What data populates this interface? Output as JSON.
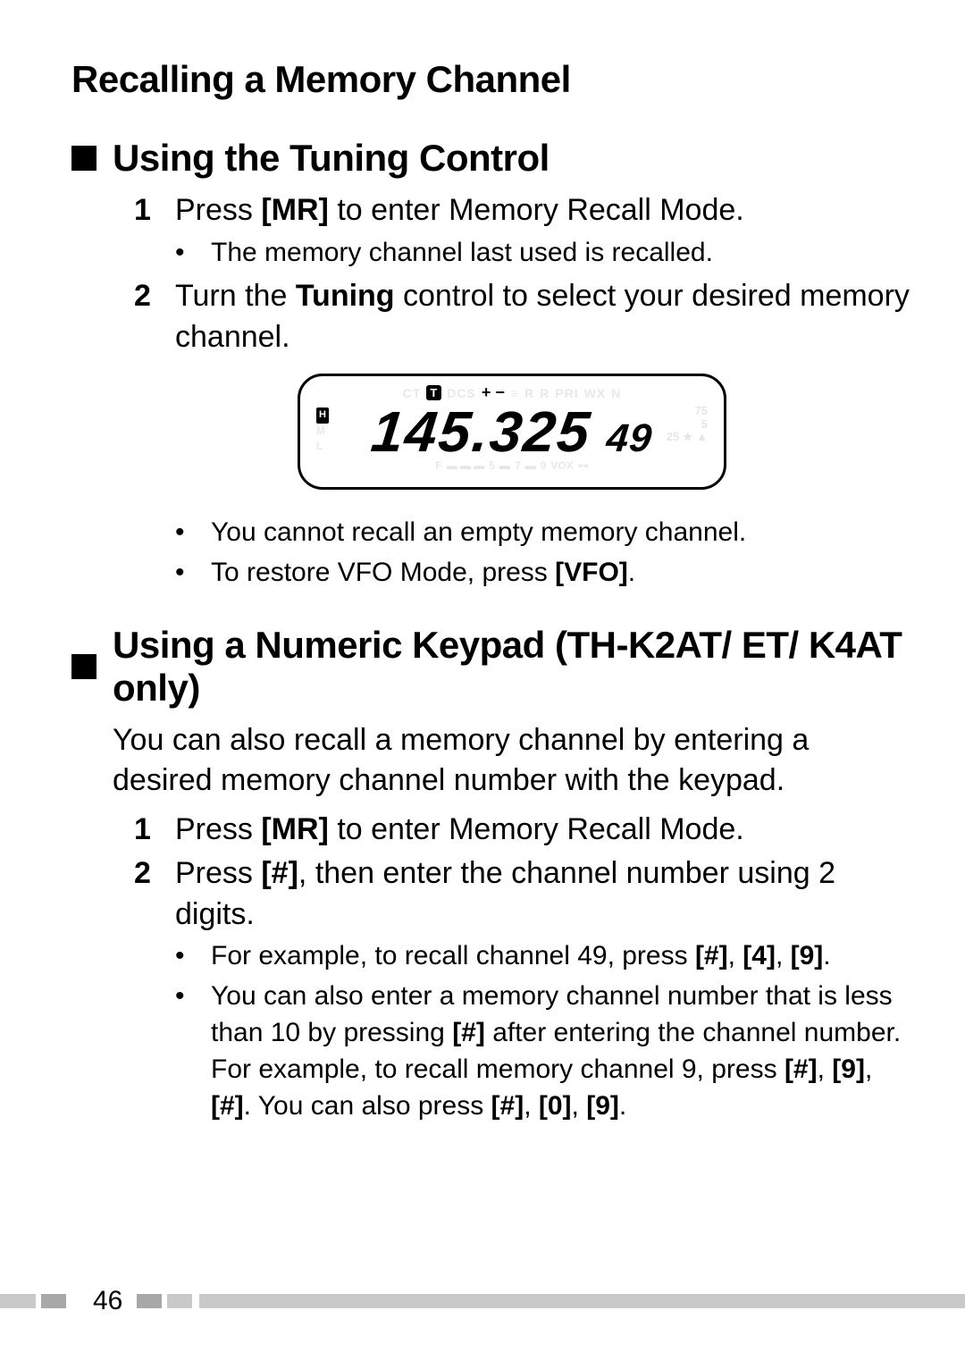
{
  "title": "Recalling a Memory Channel",
  "section1": {
    "heading": "Using the Tuning Control",
    "steps": {
      "s1": {
        "n": "1",
        "pre": "Press ",
        "key": "[MR]",
        "post": " to enter Memory Recall Mode."
      },
      "s1_bul1": "The memory channel last used is recalled.",
      "s2": {
        "n": "2",
        "pre": "Turn the ",
        "key": "Tuning",
        "post": " control to select your desired memory channel."
      },
      "s2_bul1": "You cannot recall an empty memory channel.",
      "s2_bul2_pre": "To restore VFO Mode, press ",
      "s2_bul2_key": "[VFO]",
      "s2_bul2_post": "."
    }
  },
  "lcd": {
    "topline": {
      "ct": "CT",
      "t": "T",
      "dcs": "DCS",
      "r": "R",
      "r2": "R",
      "pri": "PRI",
      "wx": "WX",
      "n": "N"
    },
    "left": {
      "h": "H",
      "m": "M",
      "l": "L"
    },
    "right": {
      "a": "75",
      "b": "5",
      "c": "25",
      "star": "★",
      "tri": "▲"
    },
    "freq": "145.325",
    "chan": "49",
    "bottom": {
      "f": "F",
      "segA": "5",
      "segB": "7",
      "segC": "9",
      "vox": "VOX",
      "key": "⊶"
    }
  },
  "section2": {
    "heading": "Using a Numeric Keypad (TH-K2AT/ ET/ K4AT only)",
    "intro": "You can also recall a memory channel by entering a desired memory channel number with the keypad.",
    "steps": {
      "s1": {
        "n": "1",
        "pre": "Press ",
        "key": "[MR]",
        "post": " to enter Memory Recall Mode."
      },
      "s2": {
        "n": "2",
        "pre": "Press ",
        "key": "[#]",
        "post": ", then enter the channel number using 2 digits."
      },
      "s2_bul1_pre": "For example, to recall channel 49, press ",
      "s2_bul1_k1": "[#]",
      "s2_bul1_c1": ", ",
      "s2_bul1_k2": "[4]",
      "s2_bul1_c2": ", ",
      "s2_bul1_k3": "[9]",
      "s2_bul1_post": ".",
      "s2_bul2_a": "You can also enter a memory channel number that is less than 10 by pressing ",
      "s2_bul2_k1": "[#]",
      "s2_bul2_b": " after entering the channel number.  For example, to recall memory channel 9, press ",
      "s2_bul2_k2": "[#]",
      "s2_bul2_c1": ", ",
      "s2_bul2_k3": "[9]",
      "s2_bul2_c2": ", ",
      "s2_bul2_k4": "[#]",
      "s2_bul2_c": ".  You can also press ",
      "s2_bul2_k5": "[#]",
      "s2_bul2_c3": ", ",
      "s2_bul2_k6": "[0]",
      "s2_bul2_c4": ", ",
      "s2_bul2_k7": "[9]",
      "s2_bul2_post": "."
    }
  },
  "page_number": "46"
}
